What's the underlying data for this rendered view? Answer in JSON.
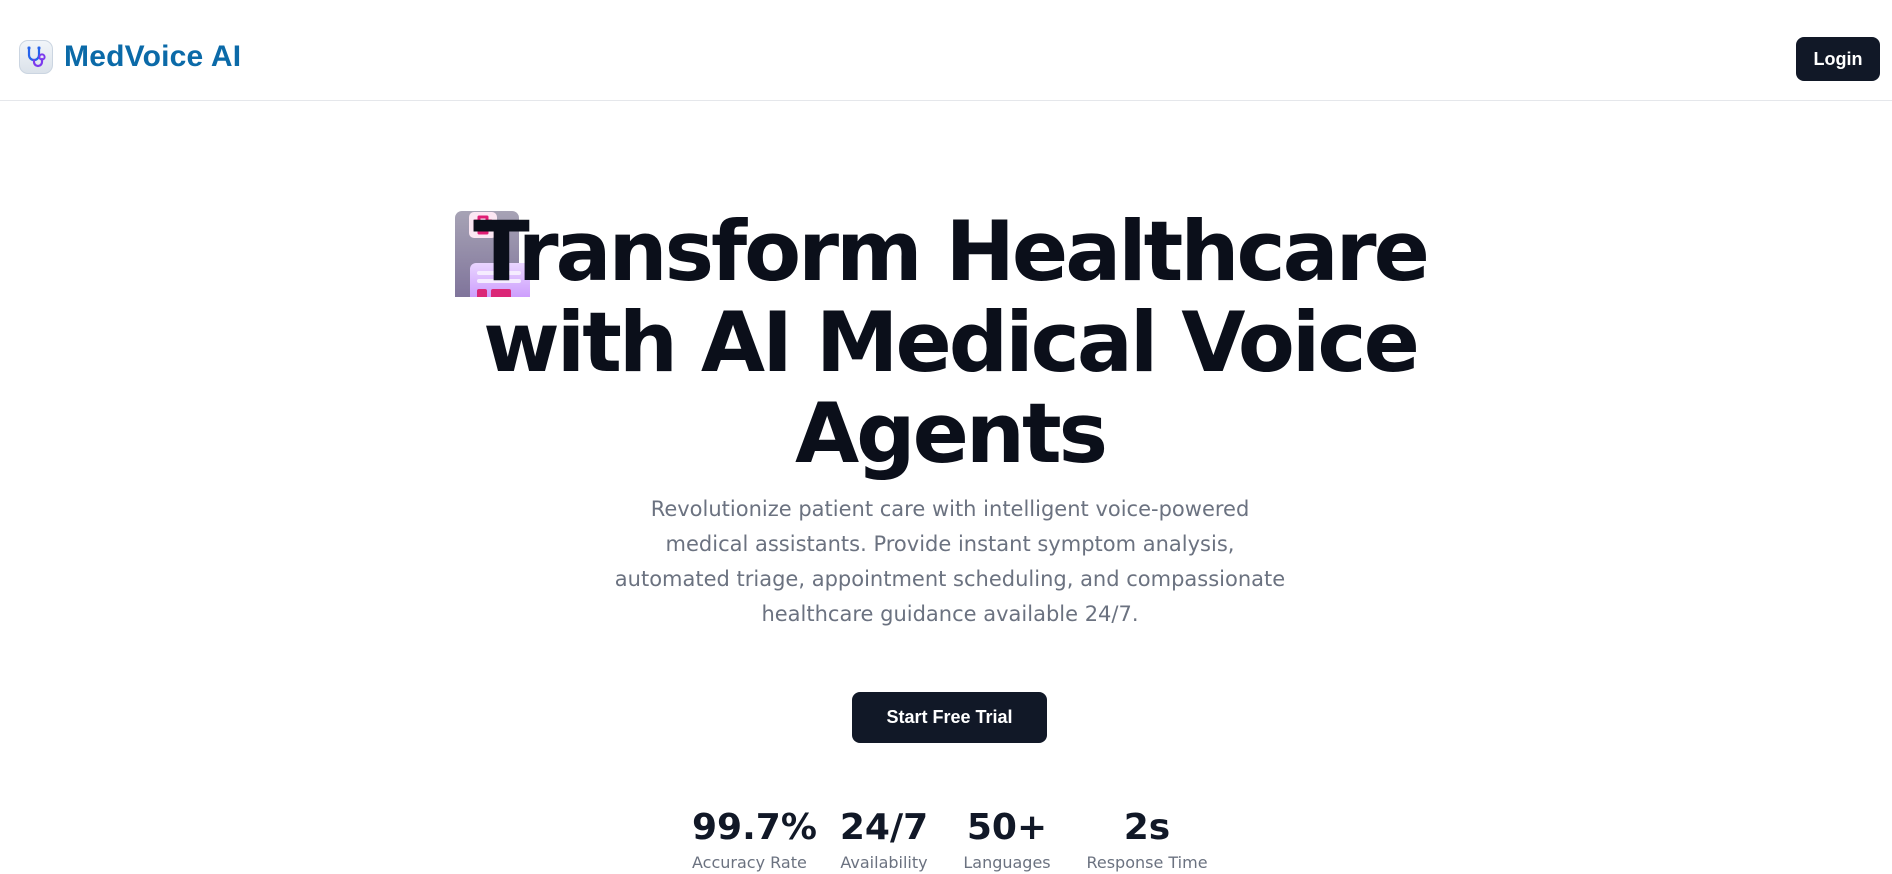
{
  "navbar": {
    "brand_name": "MedVoice AI",
    "brand_icon": "stethoscope-icon",
    "login_label": "Login"
  },
  "hero": {
    "decoration_icon": "medical-clipboard-icon",
    "title": "Transform Healthcare with AI Medical Voice Agents",
    "subtitle": "Revolutionize patient care with intelligent voice-powered medical assistants. Provide instant symptom analysis, automated triage, appointment scheduling, and compassionate healthcare guidance available 24/7.",
    "cta_label": "Start Free Trial"
  },
  "stats": [
    {
      "value": "99.7%",
      "label": "Accuracy Rate"
    },
    {
      "value": "24/7",
      "label": "Availability"
    },
    {
      "value": "50+",
      "label": "Languages"
    },
    {
      "value": "2s",
      "label": "Response Time"
    }
  ],
  "colors": {
    "brand": "#0b6aa8",
    "primary_button": "#111827",
    "title_text": "#0b0f1a",
    "muted_text": "#6b7280",
    "accent_pink": "#e11d74",
    "accent_purple": "#c084fc"
  }
}
